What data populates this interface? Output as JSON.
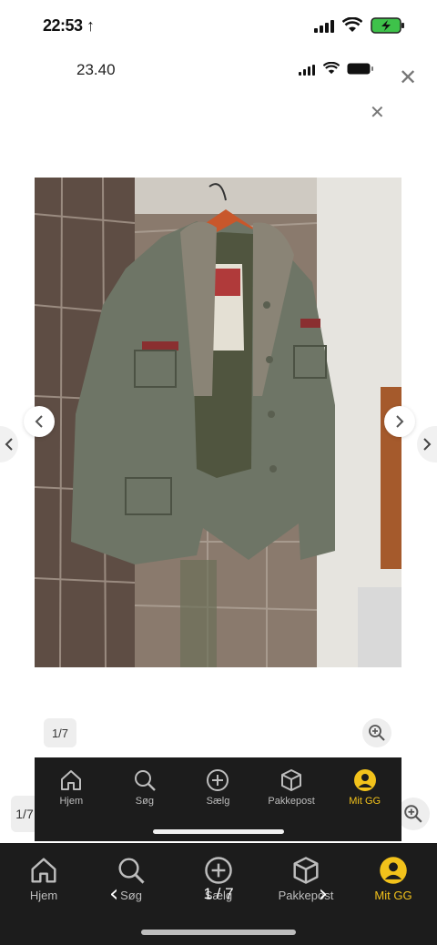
{
  "status_bar": {
    "time": "22:53 ↑"
  },
  "inner_status_bar": {
    "time": "23.40"
  },
  "gallery": {
    "counter": "1/7",
    "counter_outer": "1/7",
    "counter_bottom": "1 / 7"
  },
  "nav": {
    "items": [
      {
        "label": "Hjem",
        "icon": "home-icon"
      },
      {
        "label": "Søg",
        "icon": "search-icon"
      },
      {
        "label": "Sælg",
        "icon": "plus-circle-icon"
      },
      {
        "label": "Pakkepost",
        "icon": "package-icon"
      },
      {
        "label": "Mit GG",
        "icon": "user-circle-icon",
        "active": true
      }
    ],
    "active_color": "#f2c21b",
    "inactive_color": "#bdbdbd",
    "background": "#1c1c1c"
  }
}
